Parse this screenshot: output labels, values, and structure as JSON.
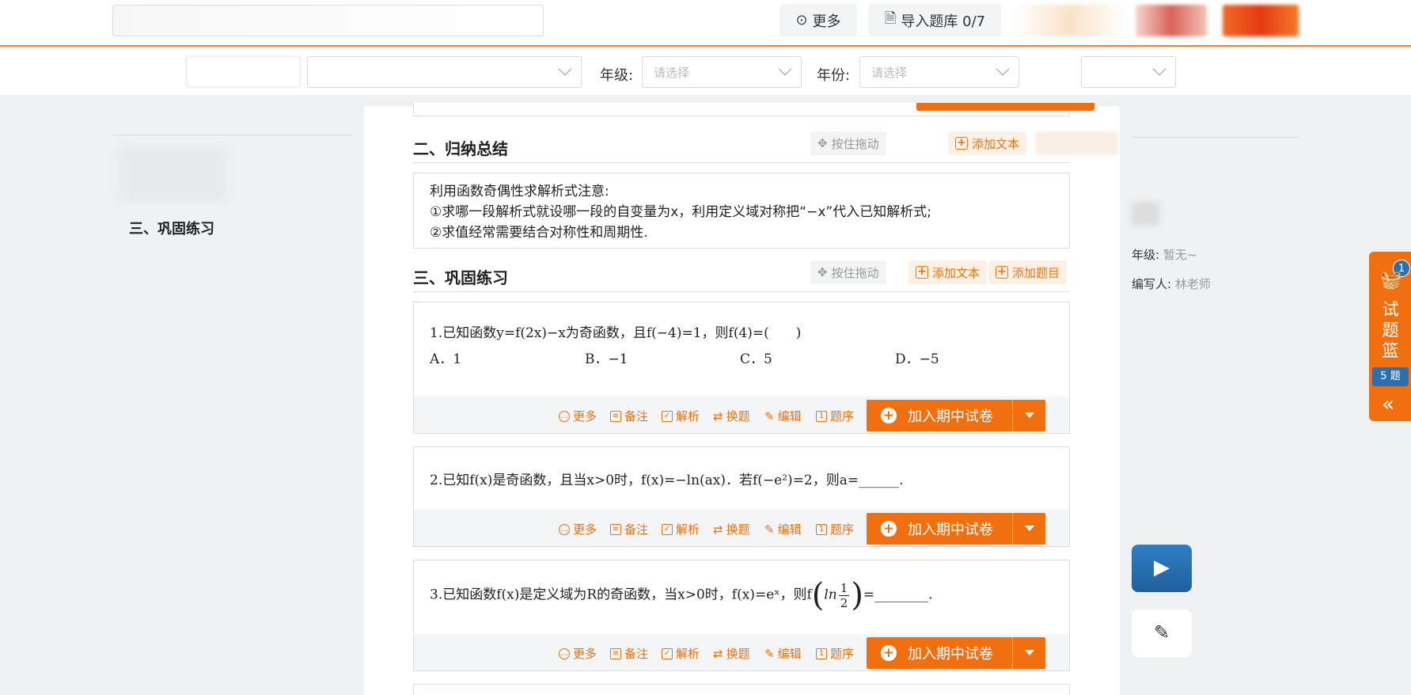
{
  "topbar": {
    "more_label": "更多",
    "import_label": "导入题库 0/7"
  },
  "filters": {
    "grade_label": "年级:",
    "grade_placeholder": "请选择",
    "year_label": "年份:",
    "year_placeholder": "请选择"
  },
  "left_nav": {
    "active_item": "三、巩固练习"
  },
  "sections": {
    "summary": {
      "title": "二、归纳总结",
      "drag_label": "按住拖动",
      "add_text_label": "添加文本",
      "lines": [
        "利用函数奇偶性求解析式注意:",
        "①求哪一段解析式就设哪一段的自变量为x，利用定义域对称把“−x”代入已知解析式;",
        "②求值经常需要结合对称性和周期性."
      ]
    },
    "practice": {
      "title": "三、巩固练习",
      "drag_label": "按住拖动",
      "add_text_label": "添加文本",
      "add_question_label": "添加题目"
    }
  },
  "questions": [
    {
      "stem": "1.已知函数y=f(2x)−x为奇函数，且f(−4)=1，则f(4)=(　　)",
      "options": [
        "A．1",
        "B．−1",
        "C．5",
        "D．−5"
      ]
    },
    {
      "stem": "2.已知f(x)是奇函数，且当x>0时，f(x)=−ln(ax)．若f(−e²)=2，则a=______."
    },
    {
      "stem_before": "3.已知函数f(x)是定义域为R的奇函数，当x>0时，f(x)=eˣ，则f",
      "ln": "ln",
      "frac_num": "1",
      "frac_den": "2",
      "stem_after": "=________."
    }
  ],
  "question_actions": {
    "more": "更多",
    "note": "备注",
    "analysis": "解析",
    "swap": "换题",
    "edit": "编辑",
    "order": "题序",
    "add_button": "加入期中试卷"
  },
  "right_panel": {
    "grade_label": "年级:",
    "grade_value": "暂无~",
    "author_label": "编写人:",
    "author_value": "林老师"
  },
  "basket": {
    "badge": "1",
    "label": "试题篮",
    "count": "5 题"
  },
  "colors": {
    "accent": "#f26f0f",
    "blue": "#2a6fb0"
  }
}
